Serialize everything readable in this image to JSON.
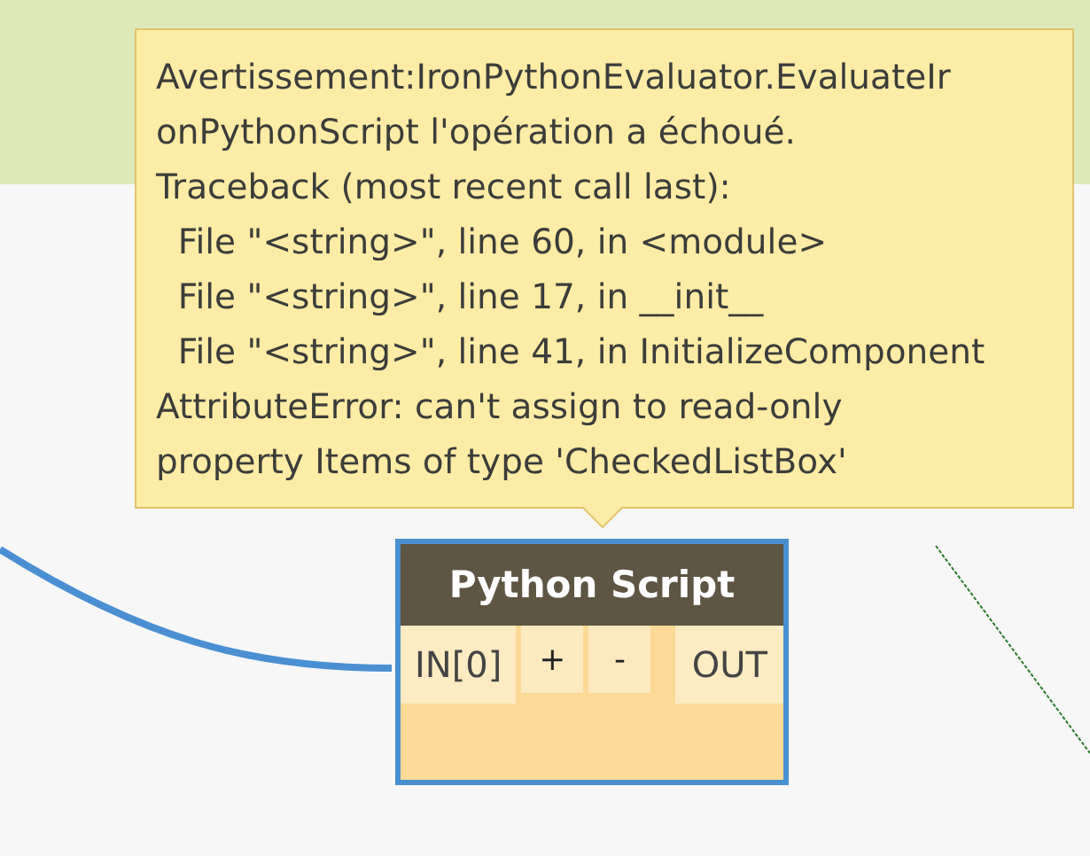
{
  "tooltip": {
    "kind": "warning",
    "lines": [
      "Avertissement:IronPythonEvaluator.EvaluateIr",
      "onPythonScript l'opération a échoué.",
      "Traceback (most recent call last):",
      "  File \"<string>\", line 60, in <module>",
      "  File \"<string>\", line 17, in __init__",
      "  File \"<string>\", line 41, in InitializeComponent",
      "AttributeError: can't assign to read-only",
      "property Items of type 'CheckedListBox'"
    ]
  },
  "node": {
    "title": "Python Script",
    "selected": true,
    "inputs": [
      "IN[0]"
    ],
    "add_label": "+",
    "remove_label": "-",
    "outputs": [
      "OUT"
    ]
  }
}
